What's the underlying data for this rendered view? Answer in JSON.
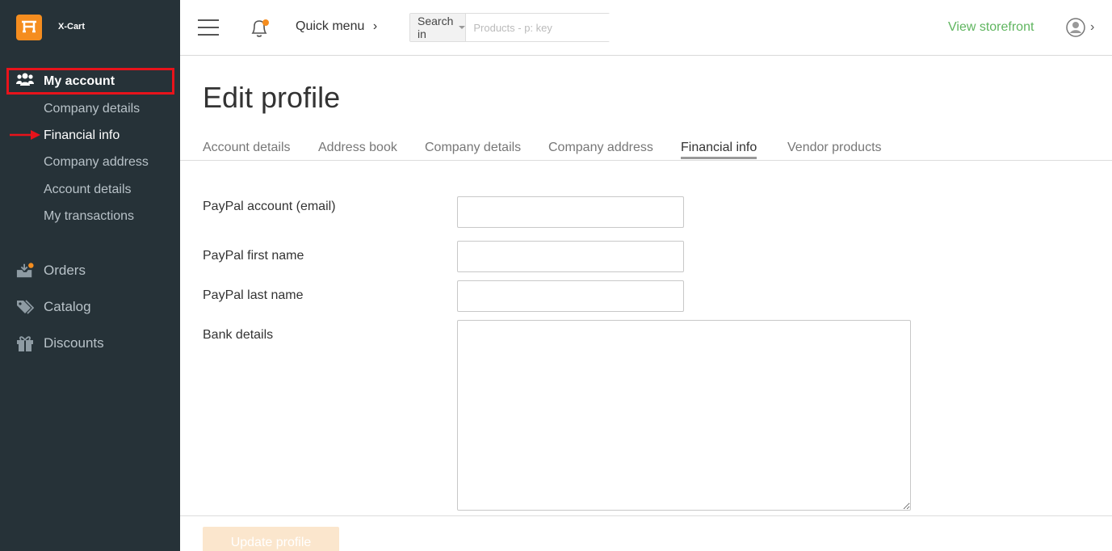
{
  "brand": {
    "name": "X-Cart"
  },
  "sidebar": {
    "my_account": "My account",
    "subitems": [
      "Company details",
      "Financial info",
      "Company address",
      "Account details",
      "My transactions"
    ],
    "main_items": [
      "Orders",
      "Catalog",
      "Discounts"
    ]
  },
  "header": {
    "quick_menu": "Quick menu",
    "search_in": "Search in",
    "search_placeholder": "Products - p: key",
    "view_storefront": "View storefront"
  },
  "page": {
    "title": "Edit profile",
    "tabs": [
      "Account details",
      "Address book",
      "Company details",
      "Company address",
      "Financial info",
      "Vendor products"
    ]
  },
  "form": {
    "paypal_email": {
      "label": "PayPal account (email)",
      "value": ""
    },
    "paypal_first": {
      "label": "PayPal first name",
      "value": ""
    },
    "paypal_last": {
      "label": "PayPal last name",
      "value": ""
    },
    "bank_details": {
      "label": "Bank details",
      "value": ""
    },
    "submit": "Update profile"
  },
  "colors": {
    "sidebar_bg": "#263238",
    "accent": "#f58d1f",
    "link_green": "#5fb55f",
    "highlight_red": "#e8131b"
  }
}
